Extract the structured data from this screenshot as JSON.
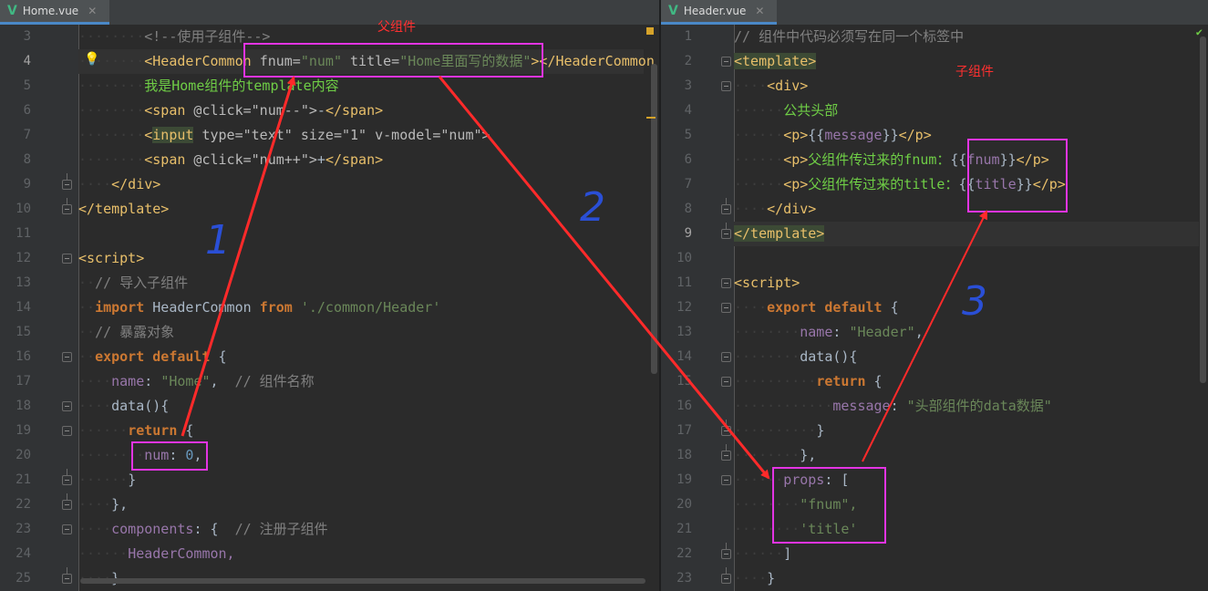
{
  "left": {
    "tab": "Home.vue",
    "line_numbers": [
      "3",
      "4",
      "5",
      "6",
      "7",
      "8",
      "9",
      "10",
      "11",
      "12",
      "13",
      "14",
      "15",
      "16",
      "17",
      "18",
      "19",
      "20",
      "21",
      "22",
      "23",
      "24",
      "25"
    ],
    "current_line": "4"
  },
  "right": {
    "tab": "Header.vue",
    "line_numbers": [
      "1",
      "2",
      "3",
      "4",
      "5",
      "6",
      "7",
      "8",
      "9",
      "10",
      "11",
      "12",
      "13",
      "14",
      "15",
      "16",
      "17",
      "18",
      "19",
      "20",
      "21",
      "22",
      "23"
    ],
    "current_line": "9"
  },
  "annotations": {
    "parent_label": "父组件",
    "child_label": "子组件",
    "step1": "1",
    "step2": "2",
    "step3": "3"
  },
  "code": {
    "l3_comment": "<!--使用子组件-->",
    "l4_open": "<HeaderCommon",
    "l4_attr1": "fnum=",
    "l4_val1": "\"num\"",
    "l4_attr2": " title=",
    "l4_val2": "\"Home里面写的数据\"",
    "l4_close": "></HeaderCommon",
    "l5_text": "我是Home组件的template内容",
    "l6_a": "<span",
    "l6_b": " @click=\"num--\">",
    "l6_c": "-",
    "l6_d": "</span>",
    "l7_a": "<",
    "l7_input": "input",
    "l7_b": " type=\"text\" size=\"1\" v-model=\"num\">",
    "l8_a": "<span",
    "l8_b": " @click=\"num++\">",
    "l8_c": "+",
    "l8_d": "</span>",
    "l9": "</div>",
    "l10": "</template>",
    "l12": "<script>",
    "l13": "// 导入子组件",
    "l14_kw": "import",
    "l14_name": " HeaderCommon ",
    "l14_from": "from",
    "l14_str": " './common/Header'",
    "l15": "// 暴露对象",
    "l16_kw": "export default",
    "l16_b": " {",
    "l17_key": "name",
    "l17_colon": ": ",
    "l17_val": "\"Home\"",
    "l17_comma": ",  ",
    "l17_cm": "// 组件名称",
    "l18": "data(){",
    "l19_kw": "return",
    "l19_b": " {",
    "l20_key": "num",
    "l20_colon": ": ",
    "l20_val": "0",
    "l20_comma": ",",
    "l21": "}",
    "l22": "},",
    "l23_key": "components",
    "l23_b": ": {  ",
    "l23_cm": "// 注册子组件",
    "l24": "HeaderCommon,",
    "l25": "}",
    "r1": "// 组件中代码必须写在同一个标签中",
    "r2": "<template>",
    "r3": "<div>",
    "r4": "公共头部",
    "r5_a": "<p>",
    "r5_b": "{{",
    "r5_c": "message",
    "r5_d": "}}",
    "r5_e": "</p>",
    "r6_a": "<p>",
    "r6_t": "父组件传过来的fnum：",
    "r6_b": "{{",
    "r6_c": "fnum",
    "r6_d": "}}",
    "r6_e": "</p>",
    "r7_a": "<p>",
    "r7_t": "父组件传过来的title：",
    "r7_b": "{{",
    "r7_c": "title",
    "r7_d": "}}",
    "r7_e": "</p>",
    "r8": "</div>",
    "r9": "</template>",
    "r11": "<script>",
    "r12_kw": "export default",
    "r12_b": " {",
    "r13_key": "name",
    "r13_colon": ": ",
    "r13_val": "\"Header\"",
    "r13_comma": ",",
    "r14": "data(){",
    "r15_kw": "return",
    "r15_b": " {",
    "r16_key": "message",
    "r16_colon": ": ",
    "r16_val": "\"头部组件的data数据\"",
    "r17": "}",
    "r18": "},",
    "r19_key": "props",
    "r19_b": ": [",
    "r20": "\"fnum\",",
    "r21": "'title'",
    "r22": "]",
    "r23": "}"
  }
}
